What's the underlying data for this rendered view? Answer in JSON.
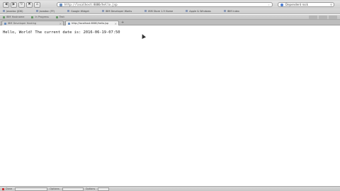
{
  "toolbar": {
    "back_icon": "back-arrow-icon",
    "forward_icon": "forward-arrow-icon",
    "reload_icon": "reload-icon",
    "stop_icon": "stop-icon",
    "home_icon": "home-icon",
    "url": "http://localhost:8080/hello.jsp",
    "search_value": "Dependent rock"
  },
  "bookmarks": [
    "Javadoc (JDK)",
    "Javadoc (FF)",
    "Google Widget",
    "IBM Developer Works",
    "IBM Store 1.9 Home",
    "Apple & Windows",
    "IBM Index"
  ],
  "secondary_toolbar": {
    "items": [
      "IBM Hostname",
      "In Progress",
      "Text"
    ]
  },
  "tabs": [
    {
      "label": "IBM Developer Hosting",
      "active": false
    },
    {
      "label": "http://localhost:8080/hello.jsp",
      "active": true
    }
  ],
  "content": {
    "line": "Hello, World! The current date is: 2016-06-19-07:50"
  },
  "statusbar": {
    "items": [
      "Done",
      "Options",
      "Options"
    ]
  },
  "colors": {
    "chrome": "#d0d0d0",
    "page_bg": "#ffffff",
    "text": "#222222"
  }
}
